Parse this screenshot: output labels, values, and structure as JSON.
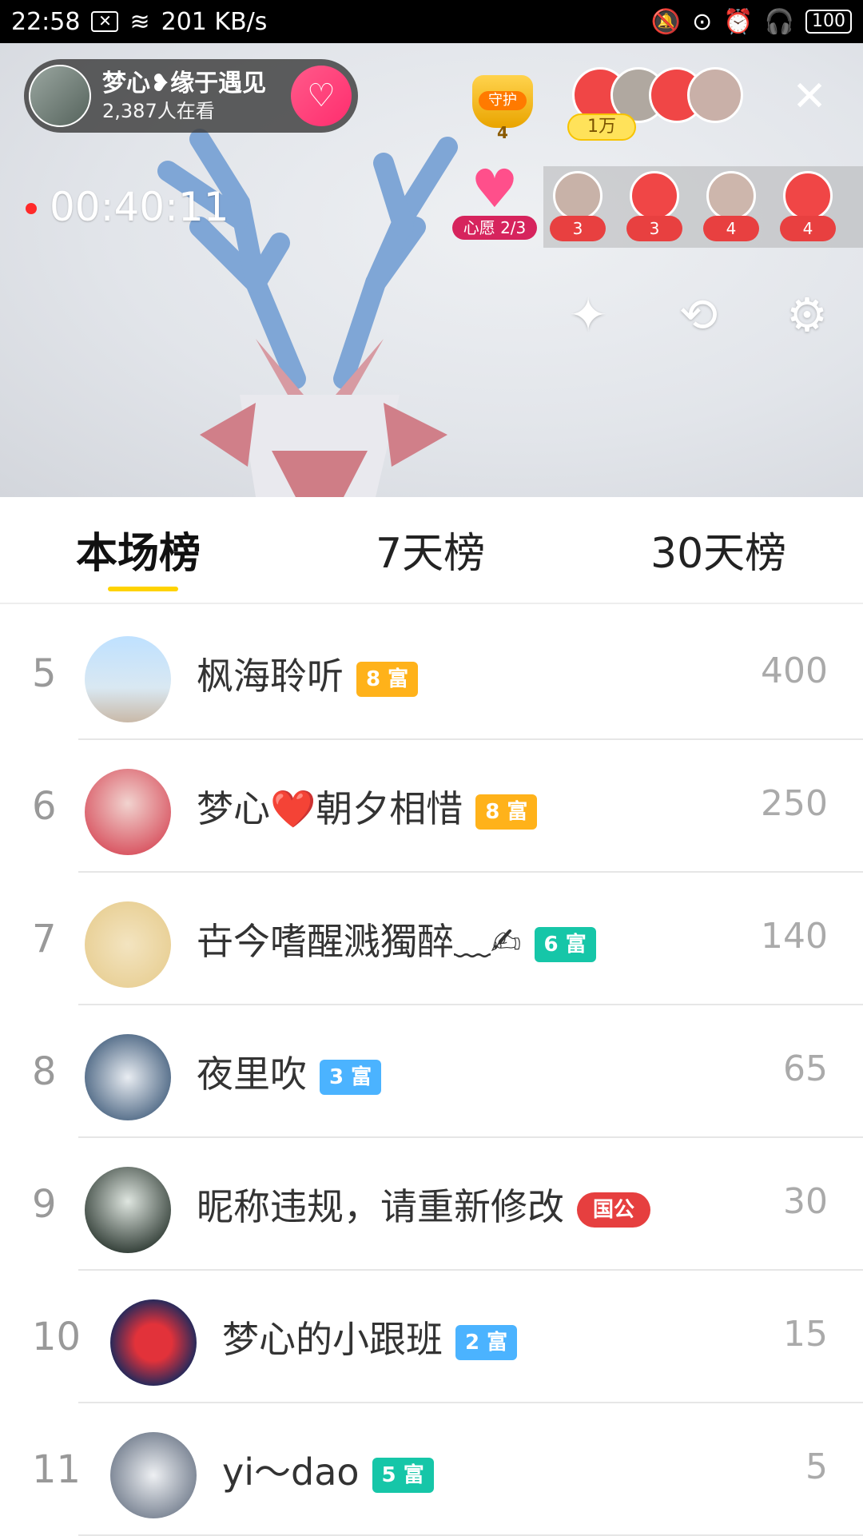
{
  "status_bar": {
    "time": "22:58",
    "network_speed": "201 KB/s",
    "battery": "100"
  },
  "anchor": {
    "name": "梦心❥缘于遇见",
    "viewers": "2,387人在看",
    "follow_icon": "heart-plus-icon"
  },
  "guard": {
    "label": "守护",
    "count": "4"
  },
  "top_viewer_badge": "1万",
  "live_timer": "00:40:11",
  "wish": {
    "label": "心愿 2/3"
  },
  "gift_counts": [
    "3",
    "3",
    "4",
    "4"
  ],
  "controls": {
    "beauty_icon": "magic-wand-icon",
    "flip_camera_icon": "camera-flip-icon",
    "settings_icon": "gear-icon",
    "close_icon": "close-icon"
  },
  "tabs": [
    {
      "label": "本场榜",
      "active": true
    },
    {
      "label": "7天榜",
      "active": false
    },
    {
      "label": "30天榜",
      "active": false
    }
  ],
  "ranking": [
    {
      "rank": "5",
      "name": "枫海聆听",
      "badge": "8 富",
      "badge_color": "#ffb21a",
      "score": "400"
    },
    {
      "rank": "6",
      "name": "梦心❤️朝夕相惜",
      "badge": "8 富",
      "badge_color": "#ffb21a",
      "score": "250"
    },
    {
      "rank": "7",
      "name": "卋今嗜醒溅獨醉﹏✍",
      "badge": "6 富",
      "badge_color": "#16c6a8",
      "score": "140"
    },
    {
      "rank": "8",
      "name": "夜里吹",
      "badge": "3 富",
      "badge_color": "#4bb3ff",
      "score": "65"
    },
    {
      "rank": "9",
      "name": "昵称违规，请重新修改",
      "badge": "国公",
      "badge_color": "#e63f3f",
      "score": "30"
    },
    {
      "rank": "10",
      "name": "梦心的小跟班",
      "badge": "2 富",
      "badge_color": "#4bb3ff",
      "score": "15"
    },
    {
      "rank": "11",
      "name": "yi～dao",
      "badge": "5 富",
      "badge_color": "#16c6a8",
      "score": "5"
    }
  ]
}
